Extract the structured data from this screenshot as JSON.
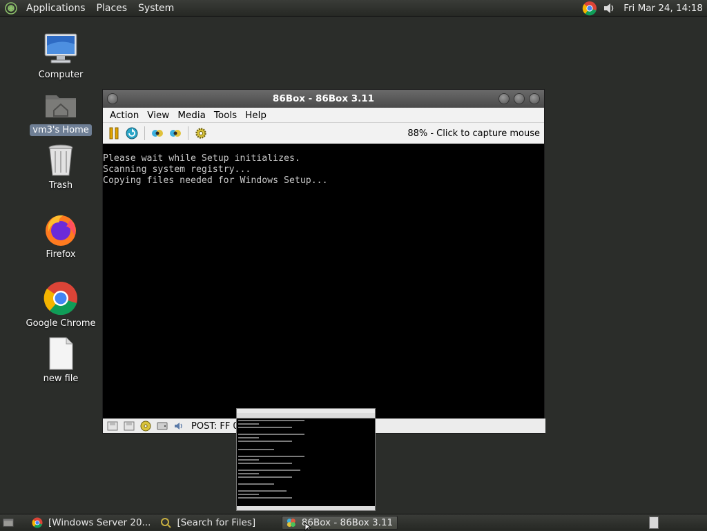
{
  "top_panel": {
    "menus": [
      "Applications",
      "Places",
      "System"
    ],
    "clock": "Fri Mar 24, 14:18",
    "tray_icons": [
      "chrome-icon",
      "volume-icon"
    ]
  },
  "desktop": {
    "icons": [
      {
        "label": "Computer",
        "icon": "computer-icon"
      },
      {
        "label": "vm3's Home",
        "icon": "home-folder-icon"
      },
      {
        "label": "Trash",
        "icon": "trash-icon"
      },
      {
        "label": "Firefox",
        "icon": "firefox-icon"
      },
      {
        "label": "Google Chrome",
        "icon": "chrome-icon"
      },
      {
        "label": "new file",
        "icon": "file-icon"
      }
    ]
  },
  "window": {
    "title": "86Box - 86Box 3.11",
    "menu": [
      "Action",
      "View",
      "Media",
      "Tools",
      "Help"
    ],
    "capture_hint": "88% - Click to capture mouse",
    "screen_lines": [
      "Please wait while Setup initializes.",
      "Scanning system registry...",
      "Copying files needed for Windows Setup..."
    ],
    "status_text": "POST: FF 0"
  },
  "taskbar": {
    "tasks": [
      {
        "label": "[Windows Server 20...",
        "icon": "chrome-icon",
        "active": false
      },
      {
        "label": "[Search for Files]",
        "icon": "search-icon",
        "active": false
      },
      {
        "label": "86Box - 86Box 3.11",
        "icon": "86box-icon",
        "active": true
      }
    ]
  },
  "colors": {
    "desktop": "#2b2d2a",
    "panel": "#2f312d",
    "titlebar": "#555555",
    "selection": "#6f7f95"
  }
}
